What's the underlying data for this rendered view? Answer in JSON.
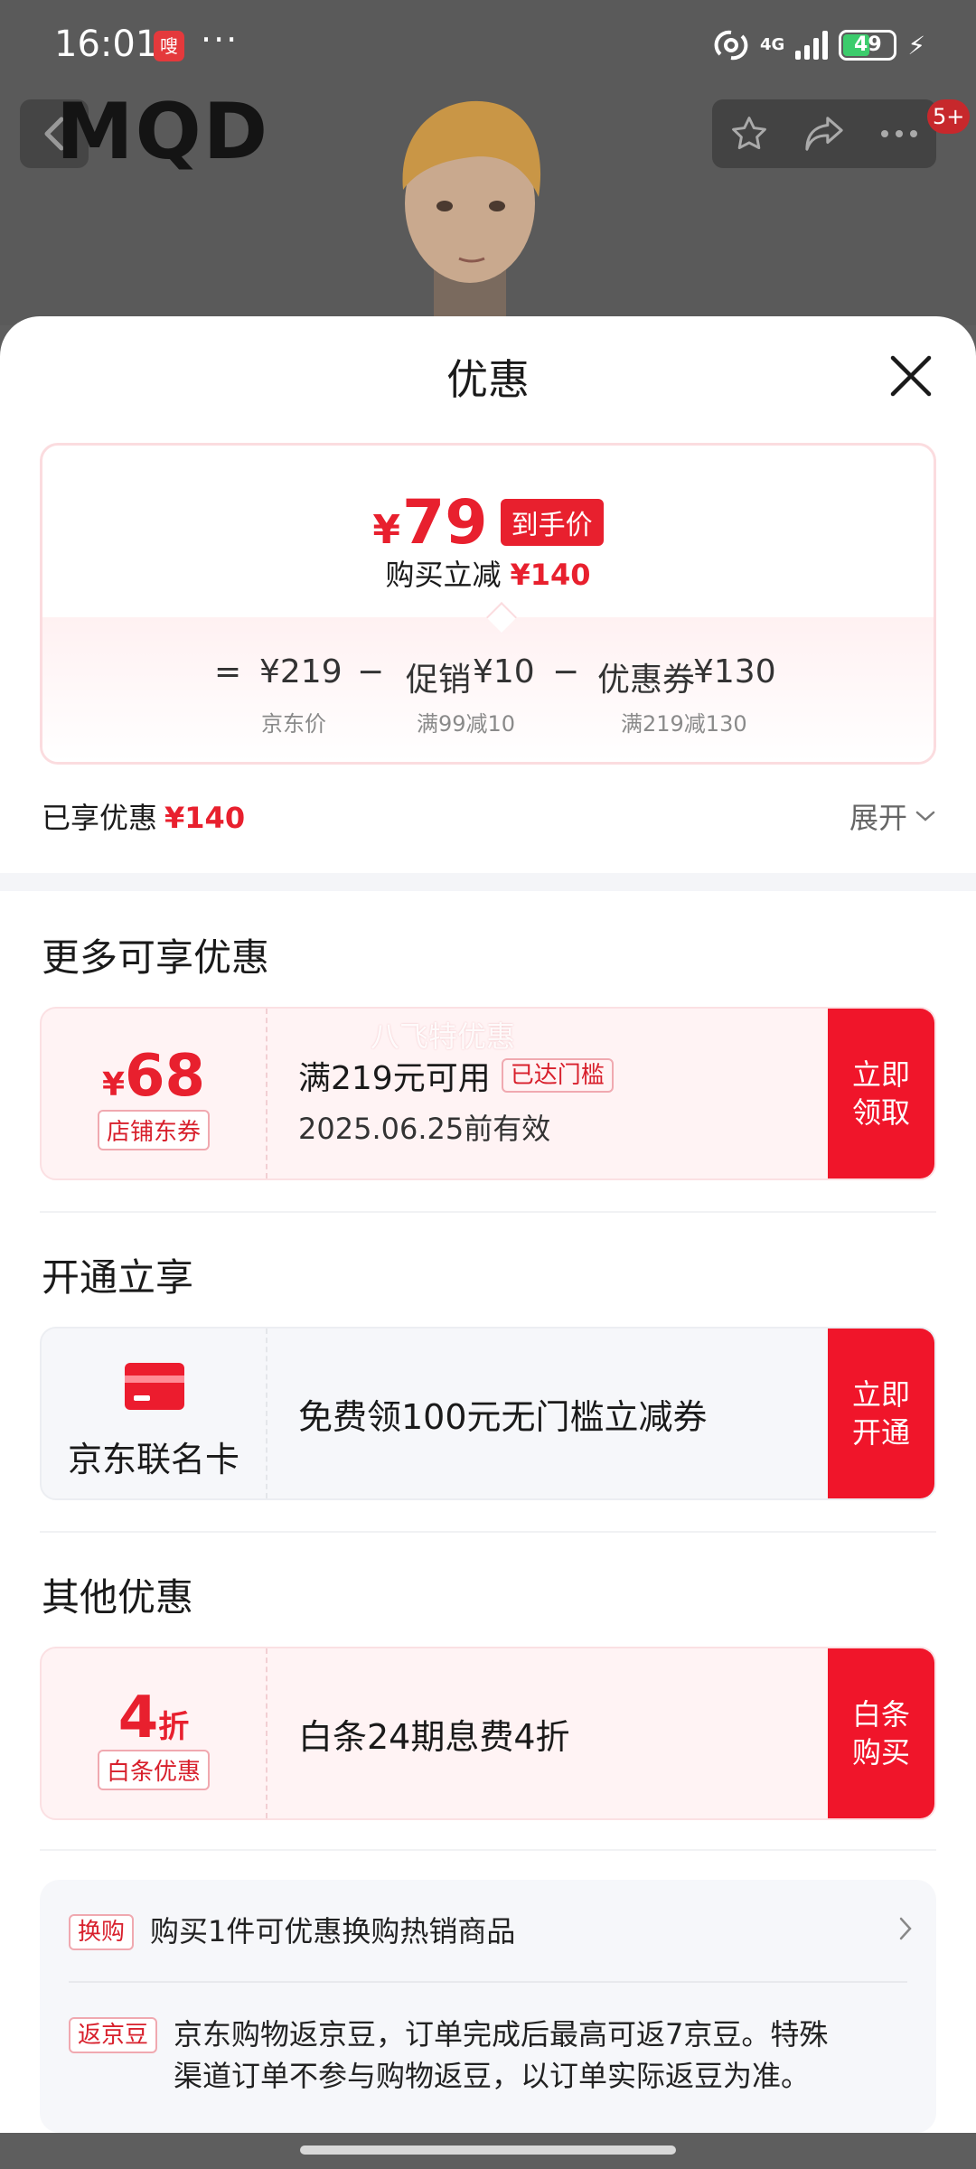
{
  "status_bar": {
    "time": "16:01",
    "app_badge": "嗖",
    "more": "···",
    "network": "4G",
    "battery": "49"
  },
  "background_page": {
    "logo": "MQD",
    "notification_count": "5+"
  },
  "sheet": {
    "title": "优惠",
    "price_card": {
      "final_currency": "¥",
      "final_price": "79",
      "final_tag": "到手价",
      "reduce_label": "购买立减",
      "reduce_amount": "¥140",
      "equals": "=",
      "minus": "−",
      "jd_price": "¥219",
      "jd_price_label": "京东价",
      "promo_label": "促销",
      "promo_amount": "¥10",
      "promo_rule": "满99减10",
      "coupon_label": "优惠券",
      "coupon_amount": "¥130",
      "coupon_rule": "满219减130"
    },
    "enjoyed_label": "已享优惠",
    "enjoyed_amount": "¥140",
    "expand_label": "展开",
    "section_more": "更多可享优惠",
    "shop_coupon": {
      "currency": "¥",
      "amount": "68",
      "tag": "店铺东券",
      "condition": "满219元可用",
      "pill": "已达门槛",
      "validity": "2025.06.25前有效",
      "button_l1": "立即",
      "button_l2": "领取"
    },
    "watermark": "八飞特优惠",
    "section_open": "开通立享",
    "card_offer": {
      "name": "京东联名卡",
      "description": "免费领100元无门槛立减券",
      "button_l1": "立即",
      "button_l2": "开通"
    },
    "section_other": "其他优惠",
    "baitiao": {
      "value": "4",
      "unit": "折",
      "tag": "白条优惠",
      "description": "白条24期息费4折",
      "button_l1": "白条",
      "button_l2": "购买"
    },
    "info": {
      "swap_tag": "换购",
      "swap_text": "购买1件可优惠换购热销商品",
      "beans_tag": "返京豆",
      "beans_line1": "京东购物返京豆，订单完成后最高可返7京豆。特殊",
      "beans_line2": "渠道订单不参与购物返豆，以订单实际返豆为准。"
    }
  },
  "colors": {
    "accent_red": "#e8202e",
    "button_red": "#f0152a"
  }
}
